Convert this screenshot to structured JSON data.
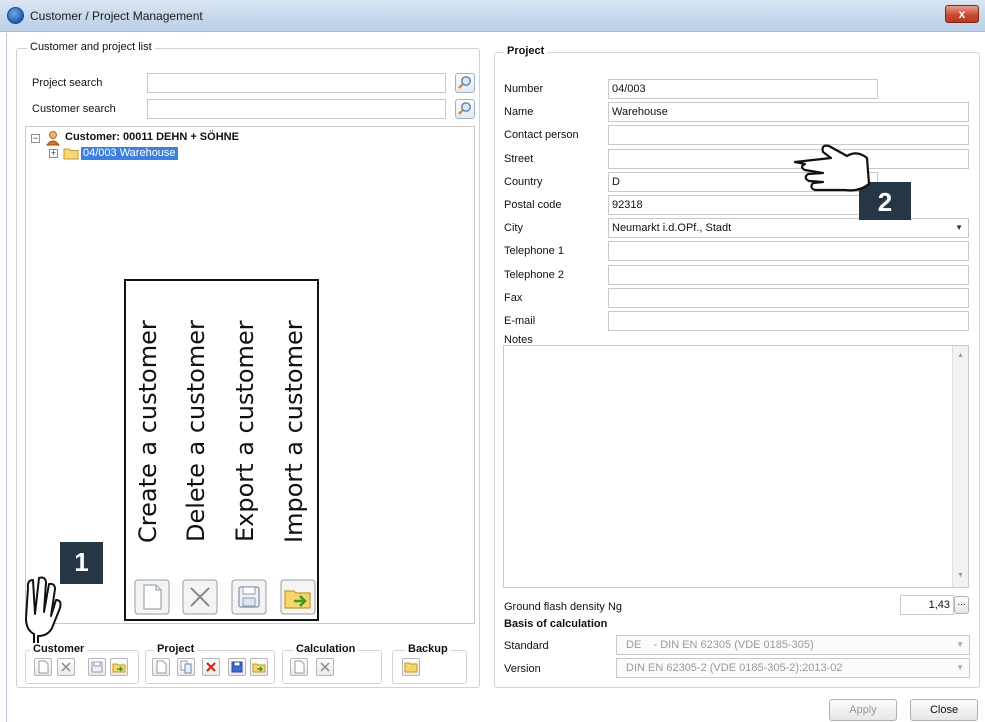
{
  "window": {
    "title": "Customer / Project Management",
    "close_label": "x"
  },
  "left_panel": {
    "caption": "Customer and project list",
    "project_search_label": "Project search",
    "customer_search_label": "Customer search",
    "project_search_value": "",
    "customer_search_value": "",
    "tree": {
      "customer_node": "Customer: 00011 DEHN + SÖHNE",
      "project_node": "04/003 Warehouse"
    },
    "overlay": {
      "labels": [
        "Create a customer",
        "Delete a customer",
        "Export a customer",
        "Import a customer"
      ]
    },
    "callout_1": "1",
    "toolbar_groups": {
      "customer": "Customer",
      "project": "Project",
      "calculation": "Calculation",
      "backup": "Backup"
    }
  },
  "project": {
    "caption": "Project",
    "fields": {
      "number_label": "Number",
      "number_value": "04/003",
      "name_label": "Name",
      "name_value": "Warehouse",
      "contact_label": "Contact person",
      "contact_value": "",
      "street_label": "Street",
      "street_value": "",
      "country_label": "Country",
      "country_value": "D",
      "postal_label": "Postal code",
      "postal_value": "92318",
      "city_label": "City",
      "city_value": "Neumarkt i.d.OPf., Stadt",
      "tel1_label": "Telephone 1",
      "tel1_value": "",
      "tel2_label": "Telephone 2",
      "tel2_value": "",
      "fax_label": "Fax",
      "fax_value": "",
      "email_label": "E-mail",
      "email_value": "",
      "notes_label": "Notes",
      "notes_value": ""
    },
    "ground_flash_label": "Ground flash density Ng",
    "ground_flash_value": "1,43",
    "ground_flash_button": "...",
    "basis_heading": "Basis of calculation",
    "standard_label": "Standard",
    "standard_value": "DE    - DIN EN 62305 (VDE 0185-305)",
    "version_label": "Version",
    "version_value": "DIN EN 62305-2 (VDE 0185-305-2):2013-02",
    "callout_2": "2"
  },
  "buttons": {
    "apply": "Apply",
    "close": "Close"
  },
  "colors": {
    "callout_bg": "#253646",
    "selection": "#3d80df"
  }
}
